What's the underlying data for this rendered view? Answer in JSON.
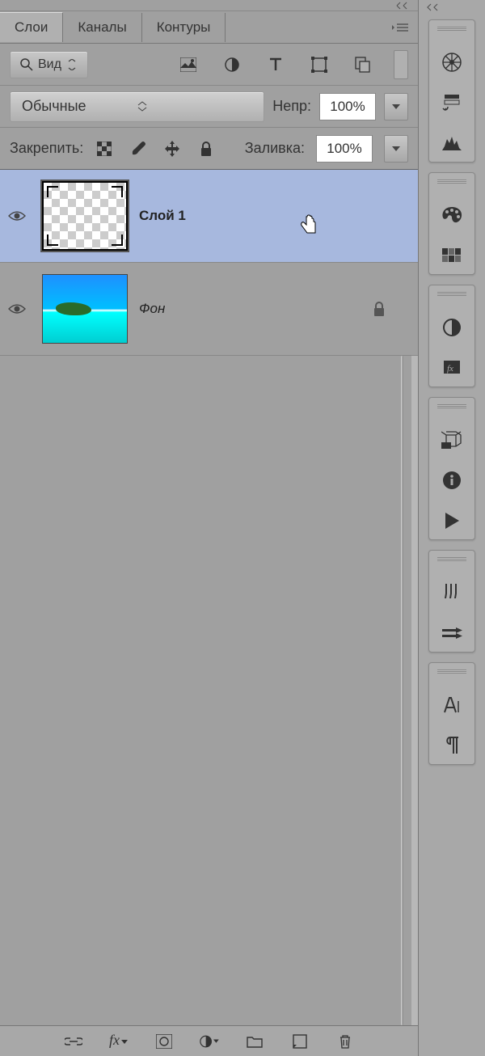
{
  "tabs": {
    "layers": "Слои",
    "channels": "Каналы",
    "paths": "Контуры"
  },
  "filter": {
    "kind": "Вид"
  },
  "blend": {
    "mode": "Обычные",
    "opacity_label": "Непр:",
    "opacity_value": "100%"
  },
  "lock": {
    "label": "Закрепить:",
    "fill_label": "Заливка:",
    "fill_value": "100%"
  },
  "layers": [
    {
      "name": "Слой 1",
      "locked": false,
      "selected": true,
      "thumb": "checker"
    },
    {
      "name": "Фон",
      "locked": true,
      "selected": false,
      "thumb": "photo"
    }
  ]
}
